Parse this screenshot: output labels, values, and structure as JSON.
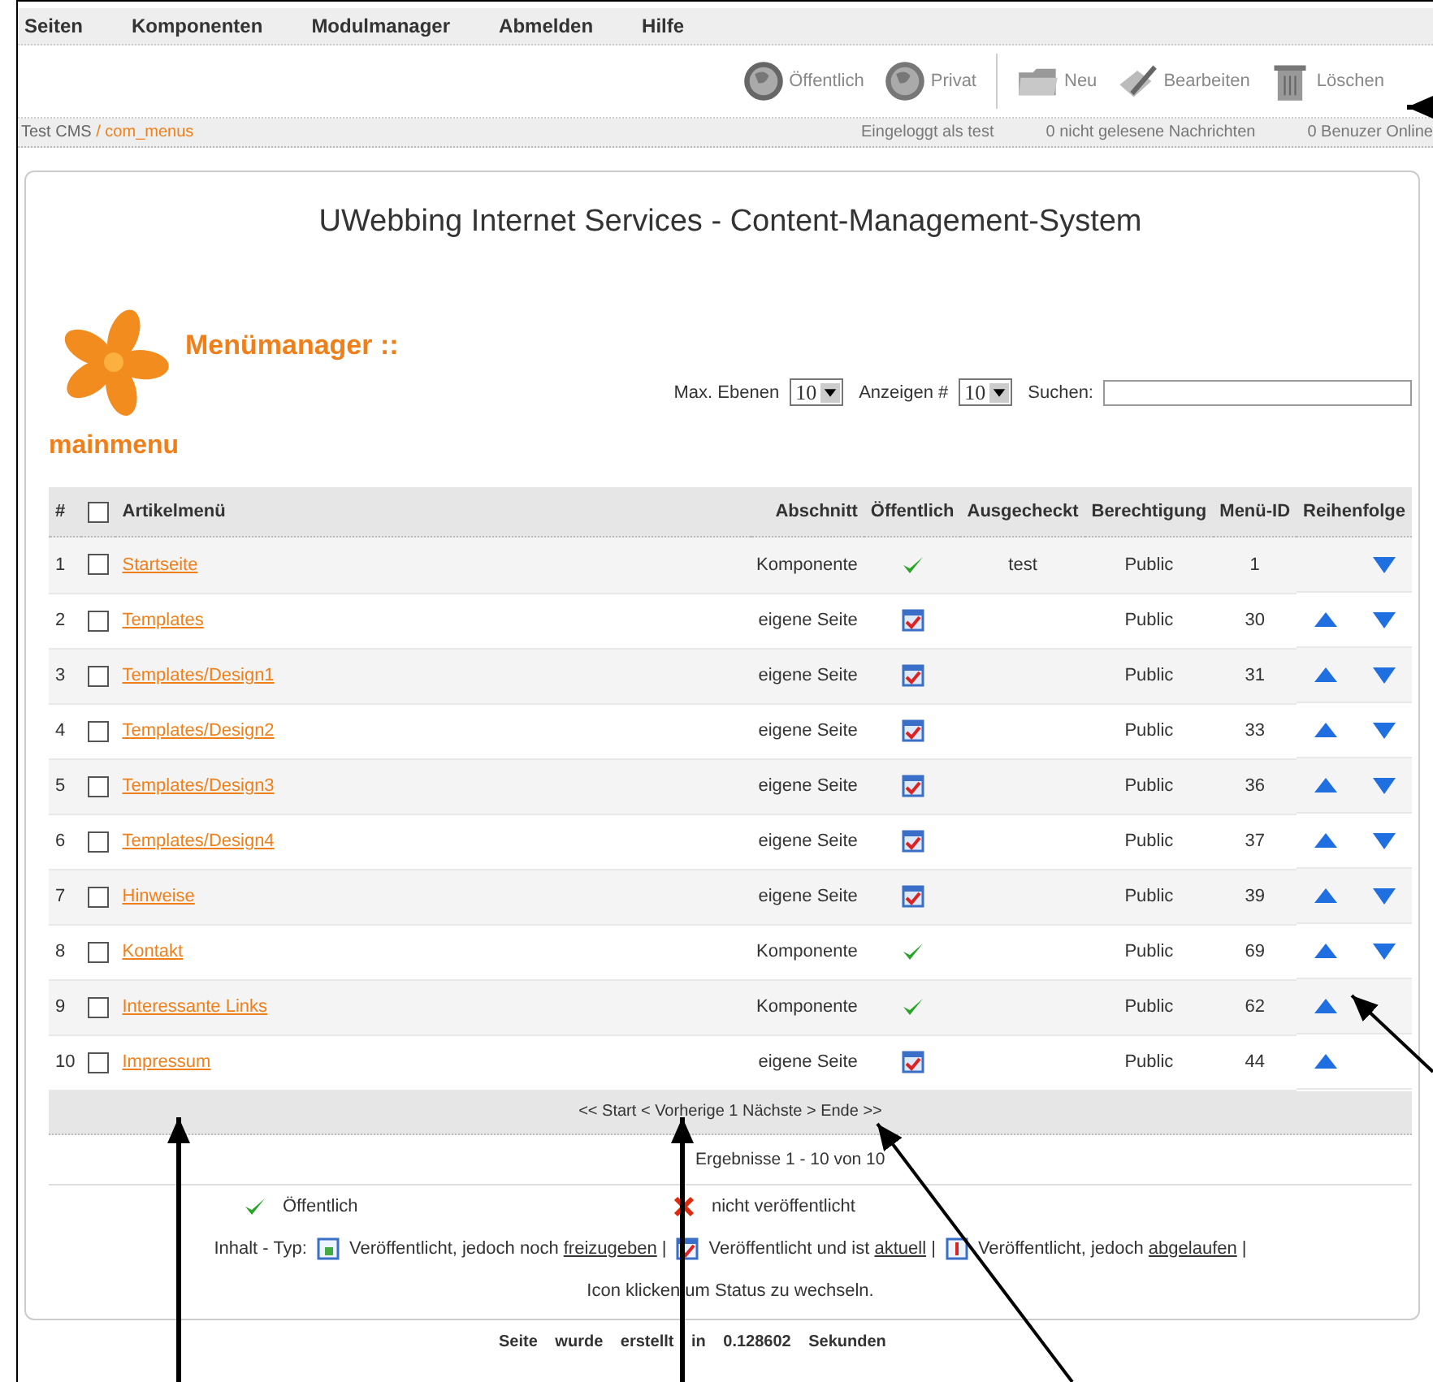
{
  "menu": [
    "Seiten",
    "Komponenten",
    "Modulmanager",
    "Abmelden",
    "Hilfe"
  ],
  "toolbar": [
    {
      "label": "Öffentlich",
      "kind": "publish"
    },
    {
      "label": "Privat",
      "kind": "unpublish"
    },
    {
      "label": "Neu",
      "kind": "new"
    },
    {
      "label": "Bearbeiten",
      "kind": "edit"
    },
    {
      "label": "Löschen",
      "kind": "delete"
    }
  ],
  "breadcrumb": {
    "site": "Test CMS",
    "separator": "/",
    "component": "com_menus"
  },
  "status": [
    "Eingeloggt als test",
    "0 nicht gelesene Nachrichten",
    "0 Benuzer Online"
  ],
  "site_title": "UWebbing Internet Services - Content-Management-System",
  "page_title": "Menümanager ::",
  "filters": {
    "levels_label": "Max. Ebenen",
    "levels_value": "10",
    "limit_label": "Anzeigen #",
    "limit_value": "10",
    "search_label": "Suchen:"
  },
  "menu_name": "mainmenu",
  "table": {
    "select_all_checked": false,
    "columns": [
      "#",
      "Artikelmenü",
      "Abschnitt",
      "Öffentlich",
      "Ausgecheckt",
      "Berechtigung",
      "Menü-ID",
      "Reihenfolge"
    ],
    "rows": [
      {
        "num": "1",
        "checked": false,
        "title": "Startseite",
        "section": "Komponente",
        "kind": "component",
        "checked_out": "test",
        "access": "Public",
        "id": "1",
        "up": false,
        "down": true
      },
      {
        "num": "2",
        "checked": false,
        "title": "Templates",
        "section": "eigene Seite",
        "kind": "page",
        "access": "Public",
        "id": "30",
        "up": true,
        "down": true
      },
      {
        "num": "3",
        "checked": false,
        "title": "Templates/Design1",
        "section": "eigene Seite",
        "kind": "page",
        "access": "Public",
        "id": "31",
        "up": true,
        "down": true
      },
      {
        "num": "4",
        "checked": false,
        "title": "Templates/Design2",
        "section": "eigene Seite",
        "kind": "page",
        "access": "Public",
        "id": "33",
        "up": true,
        "down": true
      },
      {
        "num": "5",
        "checked": false,
        "title": "Templates/Design3",
        "section": "eigene Seite",
        "kind": "page",
        "access": "Public",
        "id": "36",
        "up": true,
        "down": true
      },
      {
        "num": "6",
        "checked": false,
        "title": "Templates/Design4",
        "section": "eigene Seite",
        "kind": "page",
        "access": "Public",
        "id": "37",
        "up": true,
        "down": true
      },
      {
        "num": "7",
        "checked": false,
        "title": "Hinweise",
        "section": "eigene Seite",
        "kind": "page",
        "access": "Public",
        "id": "39",
        "up": true,
        "down": true
      },
      {
        "num": "8",
        "checked": false,
        "title": "Kontakt",
        "section": "Komponente",
        "kind": "component",
        "access": "Public",
        "id": "69",
        "up": true,
        "down": true
      },
      {
        "num": "9",
        "checked": false,
        "title": "Interessante Links",
        "section": "Komponente",
        "kind": "component",
        "access": "Public",
        "id": "62",
        "up": true,
        "down": false
      },
      {
        "num": "10",
        "checked": false,
        "title": "Impressum",
        "section": "eigene Seite",
        "kind": "page",
        "access": "Public",
        "id": "44",
        "up": true,
        "down": false
      }
    ]
  },
  "pagination": "<< Start < Vorherige 1 Nächste > Ende >>",
  "results": "Ergebnisse 1 - 10 von 10",
  "legend": {
    "published": "Öffentlich",
    "unpublished": "nicht veröffentlicht",
    "type_label": "Inhalt - Typ:",
    "types": [
      {
        "kind": "pending",
        "before": "Veröffentlicht, jedoch noch",
        "link": "freizugeben",
        "after": "|"
      },
      {
        "kind": "current",
        "before": "Veröffentlicht und ist",
        "link": "aktuell",
        "after": "|"
      },
      {
        "kind": "expired",
        "before": "Veröffentlicht, jedoch",
        "link": "abgelaufen",
        "after": "|"
      }
    ],
    "hint": "Icon klicken um Status zu wechseln."
  },
  "footer": "Seite wurde erstellt in 0.128602 Sekunden"
}
